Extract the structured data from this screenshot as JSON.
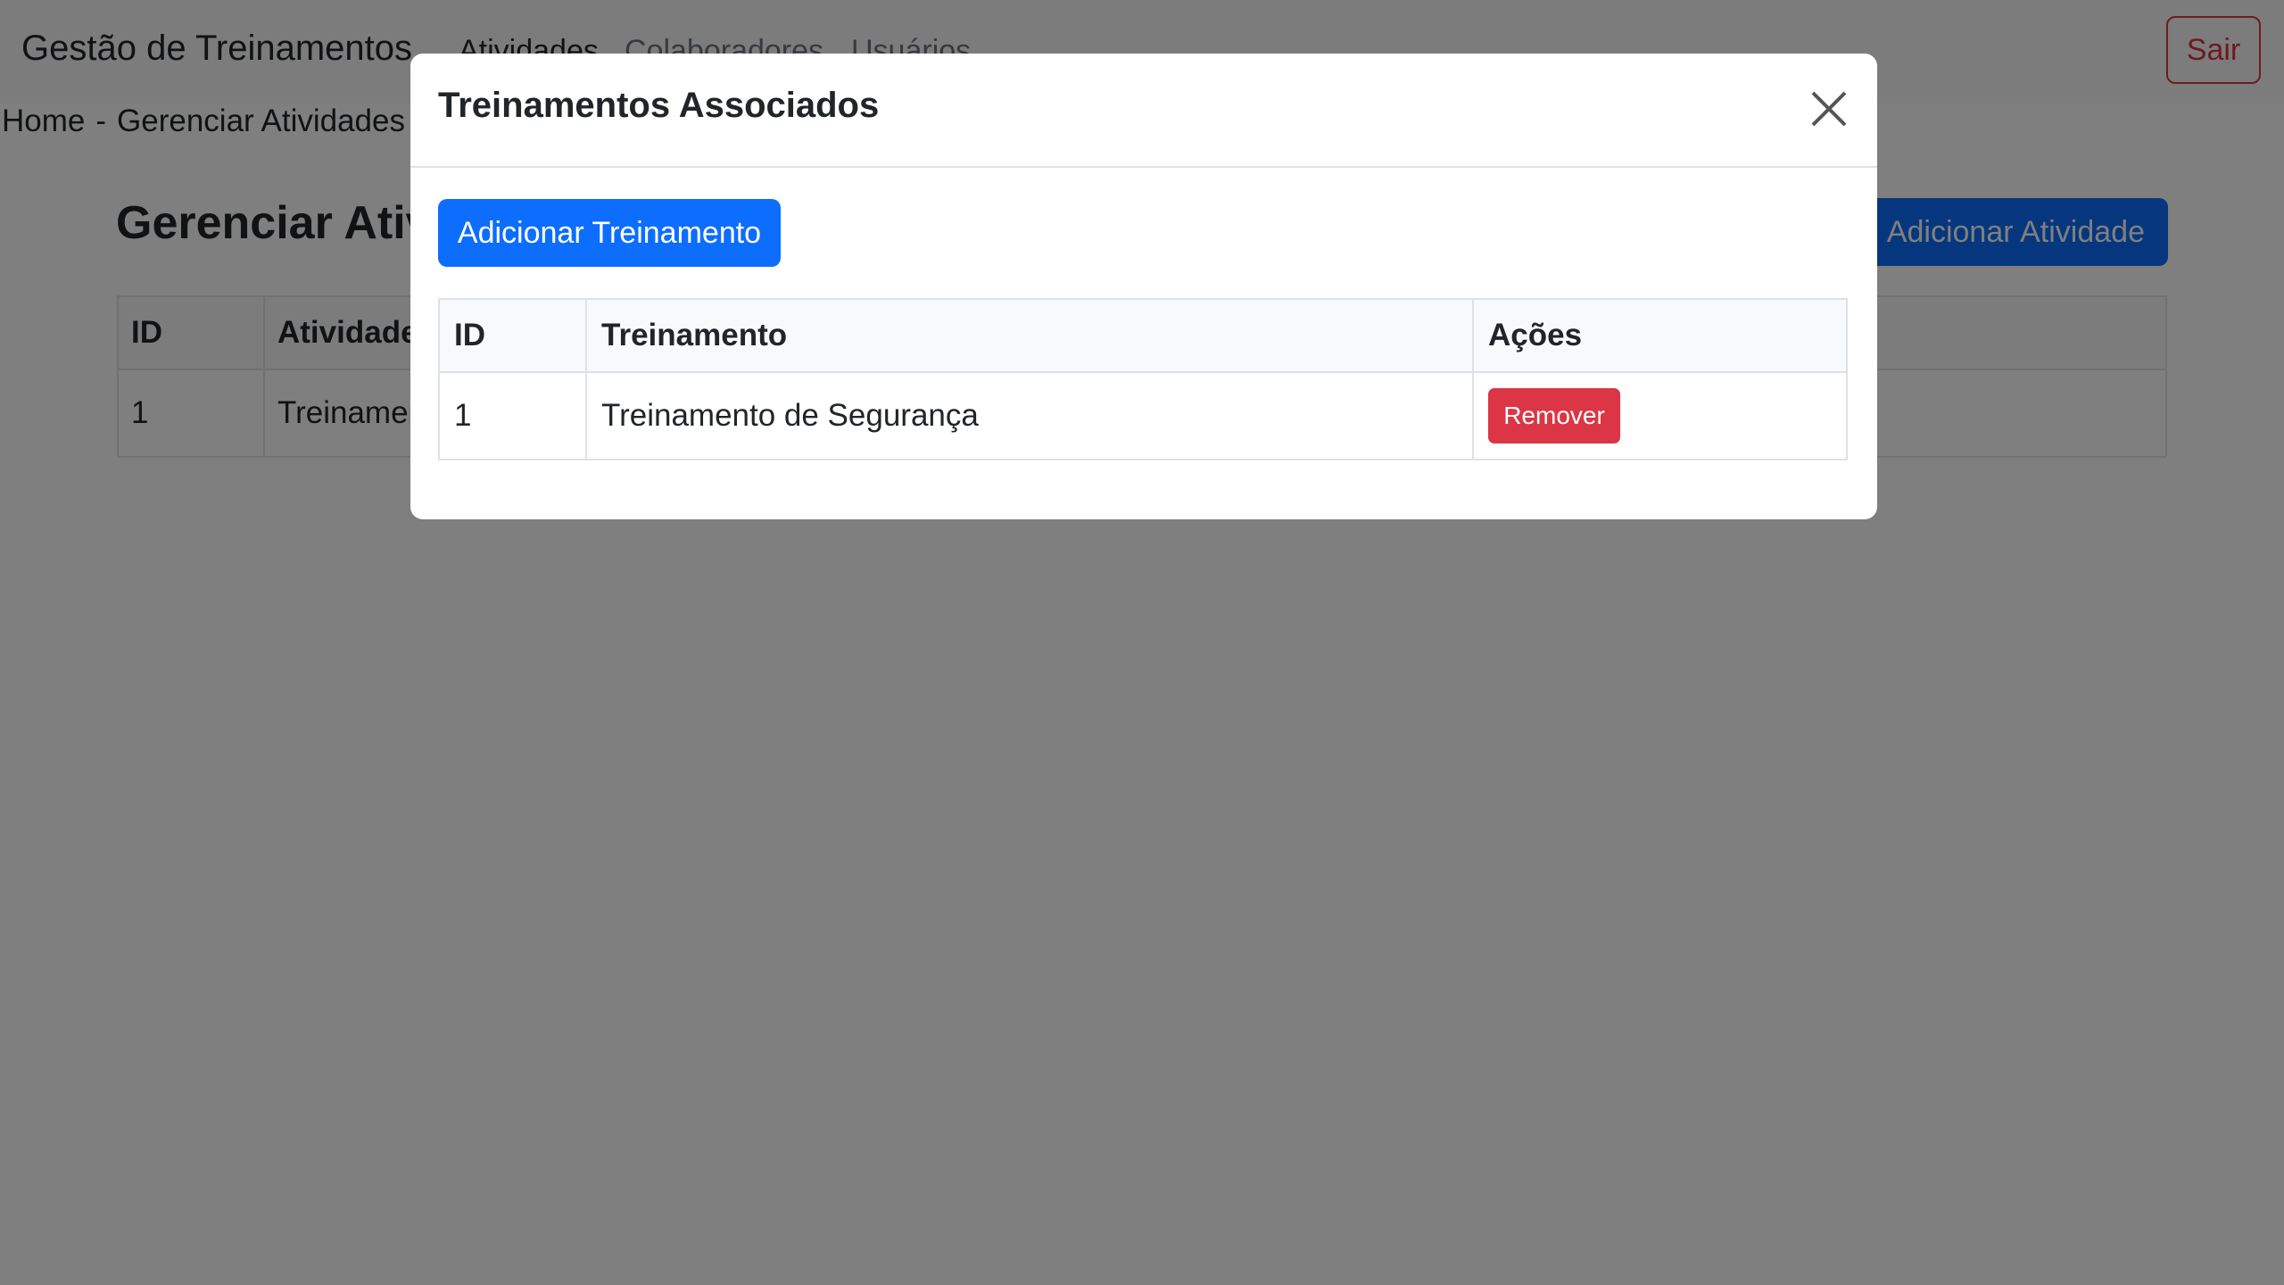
{
  "navbar": {
    "brand": "Gestão de Treinamentos",
    "links": [
      {
        "label": "Atividades"
      },
      {
        "label": "Colaboradores"
      },
      {
        "label": "Usuários"
      }
    ],
    "logout_label": "Sair"
  },
  "breadcrumb": {
    "home": "Home",
    "separator": "-",
    "current": "Gerenciar Atividades"
  },
  "page": {
    "title": "Gerenciar Atividades",
    "add_button_label": "Adicionar Atividade",
    "table": {
      "headers": [
        "ID",
        "Atividade"
      ],
      "rows": [
        {
          "id": "1",
          "atividade": "Treinamento"
        }
      ]
    }
  },
  "modal": {
    "title": "Treinamentos Associados",
    "close_icon": "close-icon",
    "add_button_label": "Adicionar Treinamento",
    "table": {
      "headers": [
        "ID",
        "Treinamento",
        "Ações"
      ],
      "rows": [
        {
          "id": "1",
          "treinamento": "Treinamento de Segurança",
          "action_label": "Remover"
        }
      ]
    }
  },
  "colors": {
    "primary": "#0d6efd",
    "danger": "#dc3545",
    "backdrop": "rgba(0,0,0,0.5)"
  }
}
